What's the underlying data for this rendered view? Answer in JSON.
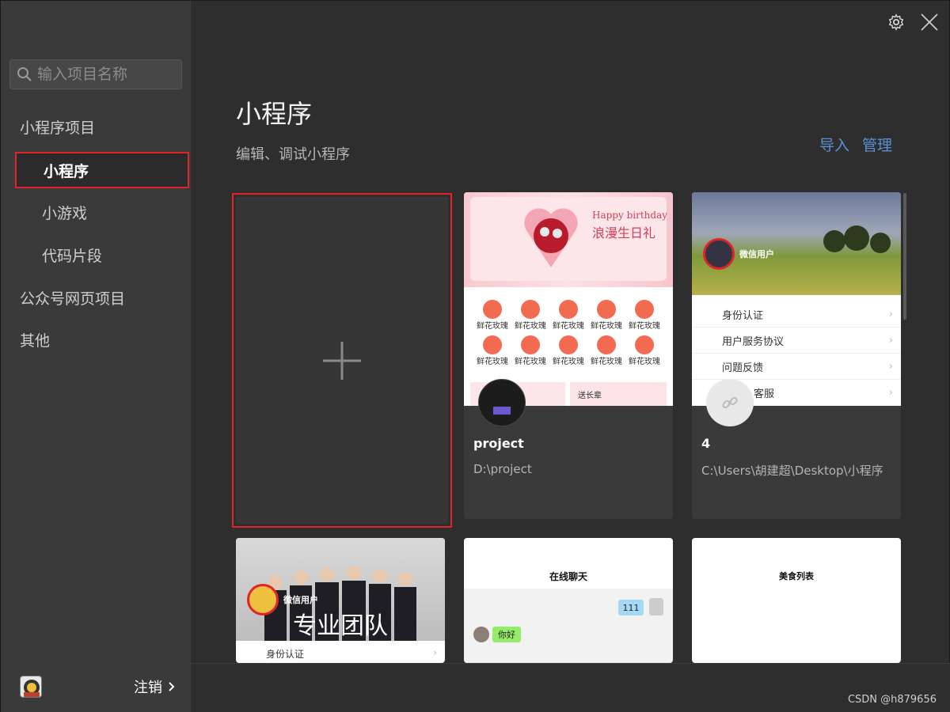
{
  "sidebar": {
    "search_placeholder": "输入项目名称",
    "category_miniprogram": "小程序项目",
    "items": [
      {
        "label": "小程序",
        "active": true
      },
      {
        "label": "小游戏"
      },
      {
        "label": "代码片段"
      }
    ],
    "category_web": "公众号网页项目",
    "category_other": "其他",
    "logout_label": "注销"
  },
  "header": {
    "title": "小程序",
    "subtitle": "编辑、调试小程序",
    "import_label": "导入",
    "manage_label": "管理"
  },
  "projects": [
    {
      "name": "project",
      "path": "D:\\project",
      "thumb": {
        "banner_en": "Happy birthday",
        "banner_cn": "浪漫生日礼",
        "grid_label": "鲜花玫瑰",
        "side_label": "送长辈"
      }
    },
    {
      "name": "4",
      "path": "C:\\Users\\胡建超\\Desktop\\小程序",
      "thumb": {
        "user_label": "微信用户",
        "menu": [
          "身份认证",
          "用户服务协议",
          "问题反馈",
          "客服"
        ]
      }
    }
  ],
  "more_projects": [
    {
      "thumb_user": "微信用户",
      "thumb_banner": "专业团队",
      "thumb_menu": "身份认证"
    },
    {
      "thumb_title": "在线聊天",
      "bubble_right": "111",
      "bubble_left": "你好"
    },
    {
      "thumb_title": "美食列表"
    }
  ],
  "watermark": "CSDN @h879656",
  "colors": {
    "accent_blue": "#5b8fd6",
    "highlight_red": "#e0242a",
    "sidebar_bg": "#3a3a3a",
    "main_bg": "#2e2e2e"
  }
}
